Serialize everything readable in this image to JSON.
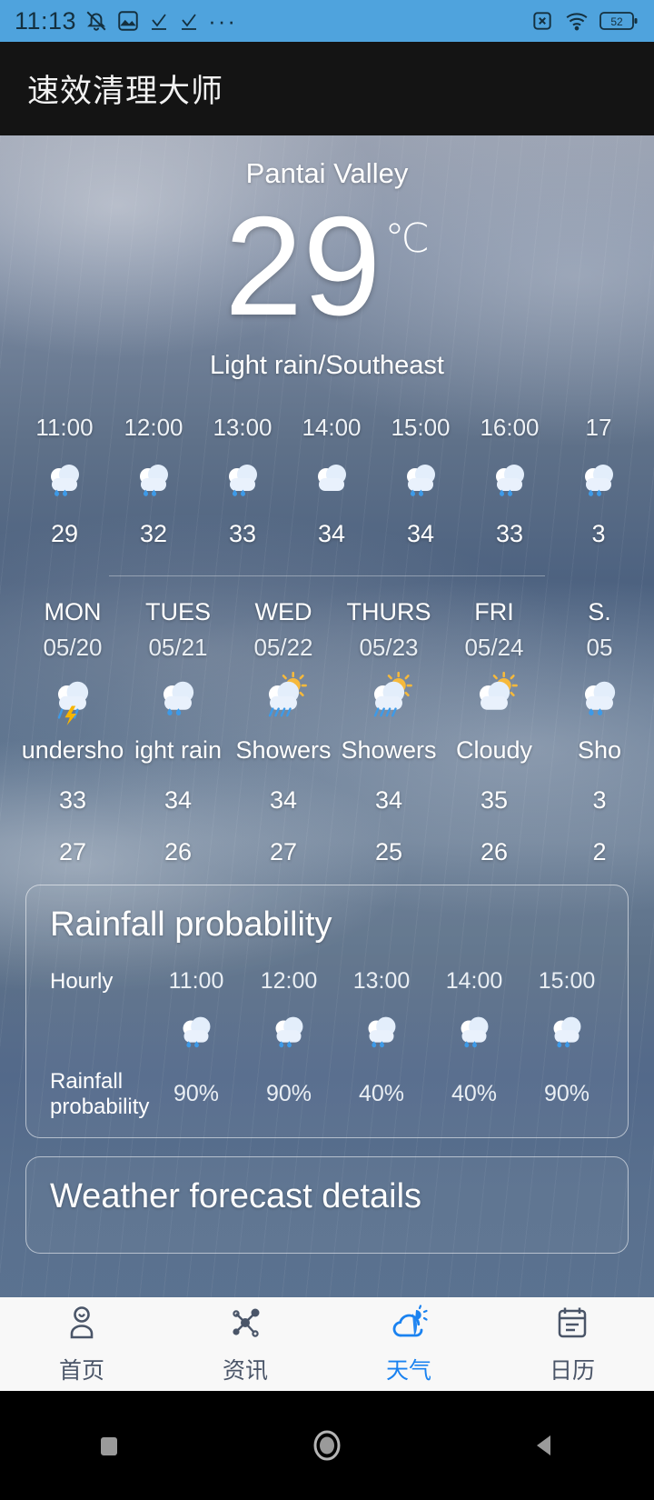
{
  "status_bar": {
    "time": "11:13",
    "battery_level": "52",
    "icons": [
      "mute-icon",
      "image-icon",
      "check-icon",
      "check-icon",
      "more-dots-icon",
      "sim-disabled-icon",
      "wifi-icon",
      "battery-icon"
    ]
  },
  "app_bar": {
    "title": "速效清理大师"
  },
  "current": {
    "city": "Pantai Valley",
    "temperature": "29",
    "unit": "℃",
    "condition": "Light rain/Southeast"
  },
  "hourly": {
    "items": [
      {
        "time": "11:00",
        "icon": "rain-cloud-icon",
        "temp": "29"
      },
      {
        "time": "12:00",
        "icon": "rain-cloud-icon",
        "temp": "32"
      },
      {
        "time": "13:00",
        "icon": "rain-cloud-icon",
        "temp": "33"
      },
      {
        "time": "14:00",
        "icon": "cloud-icon",
        "temp": "34"
      },
      {
        "time": "15:00",
        "icon": "rain-cloud-icon",
        "temp": "34"
      },
      {
        "time": "16:00",
        "icon": "rain-cloud-icon",
        "temp": "33"
      },
      {
        "time": "17",
        "icon": "rain-cloud-icon",
        "temp": "3"
      }
    ]
  },
  "daily": {
    "items": [
      {
        "name": "MON",
        "date": "05/20",
        "icon": "thunderstorm-icon",
        "desc": "undersho",
        "high": "33",
        "low": "27"
      },
      {
        "name": "TUES",
        "date": "05/21",
        "icon": "rain-cloud-icon",
        "desc": "ight rain",
        "high": "34",
        "low": "26"
      },
      {
        "name": "WED",
        "date": "05/22",
        "icon": "sun-shower-icon",
        "desc": "Showers",
        "high": "34",
        "low": "27"
      },
      {
        "name": "THURS",
        "date": "05/23",
        "icon": "sun-shower-icon",
        "desc": "Showers",
        "high": "34",
        "low": "25"
      },
      {
        "name": "FRI",
        "date": "05/24",
        "icon": "sun-cloud-icon",
        "desc": "Cloudy",
        "high": "35",
        "low": "26"
      },
      {
        "name": "S.",
        "date": "05",
        "icon": "rain-cloud-icon",
        "desc": "Sho",
        "high": "3",
        "low": "2"
      }
    ]
  },
  "rainfall_card": {
    "title": "Rainfall probability",
    "row_hourly_label": "Hourly",
    "row_probability_label": "Rainfall probability",
    "times": [
      "11:00",
      "12:00",
      "13:00",
      "14:00",
      "15:00"
    ],
    "icons": [
      "rain-cloud-icon",
      "rain-cloud-icon",
      "rain-cloud-icon",
      "rain-cloud-icon",
      "rain-cloud-icon"
    ],
    "probabilities": [
      "90%",
      "90%",
      "40%",
      "40%",
      "90%"
    ]
  },
  "details_card": {
    "title": "Weather forecast details"
  },
  "bottom_nav": {
    "active_color": "#1a82f0",
    "items": [
      {
        "label": "首页",
        "icon": "person-icon",
        "active": false
      },
      {
        "label": "资讯",
        "icon": "network-icon",
        "active": false
      },
      {
        "label": "天气",
        "icon": "weather-icon",
        "active": true
      },
      {
        "label": "日历",
        "icon": "calendar-icon",
        "active": false
      }
    ]
  },
  "system_bar": {
    "buttons": [
      {
        "icon": "recents-square-icon"
      },
      {
        "icon": "home-circle-icon"
      },
      {
        "icon": "back-triangle-icon"
      }
    ]
  }
}
